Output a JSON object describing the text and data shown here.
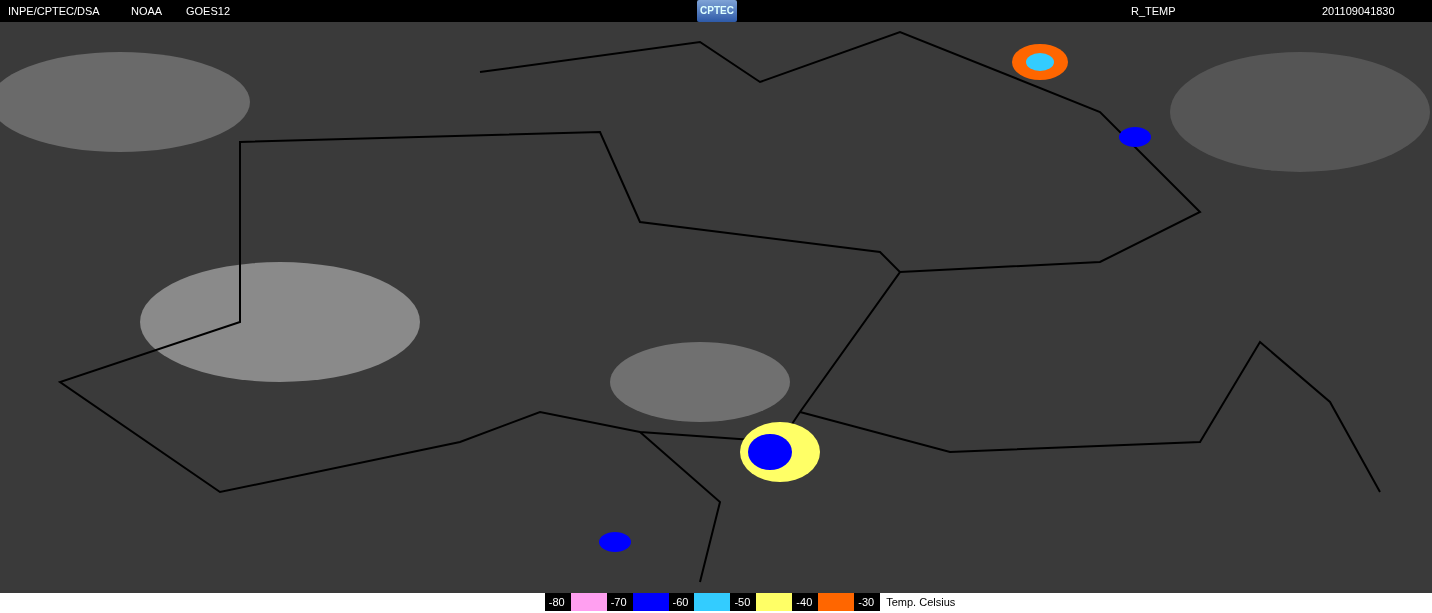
{
  "header": {
    "source": "INPE/CPTEC/DSA",
    "agency": "NOAA",
    "satellite": "GOES12",
    "logo": "CPTEC",
    "product": "R_TEMP",
    "timestamp": "201109041830"
  },
  "legend": {
    "scale": [
      {
        "label": "-80",
        "color": "#ff9ff0"
      },
      {
        "label": "-70",
        "color": "#0000ff"
      },
      {
        "label": "-60",
        "color": "#33ccff"
      },
      {
        "label": "-50",
        "color": "#ffff66"
      },
      {
        "label": "-40",
        "color": "#ff6600"
      },
      {
        "label": "-30"
      }
    ],
    "title": "Temp. Celsius"
  }
}
